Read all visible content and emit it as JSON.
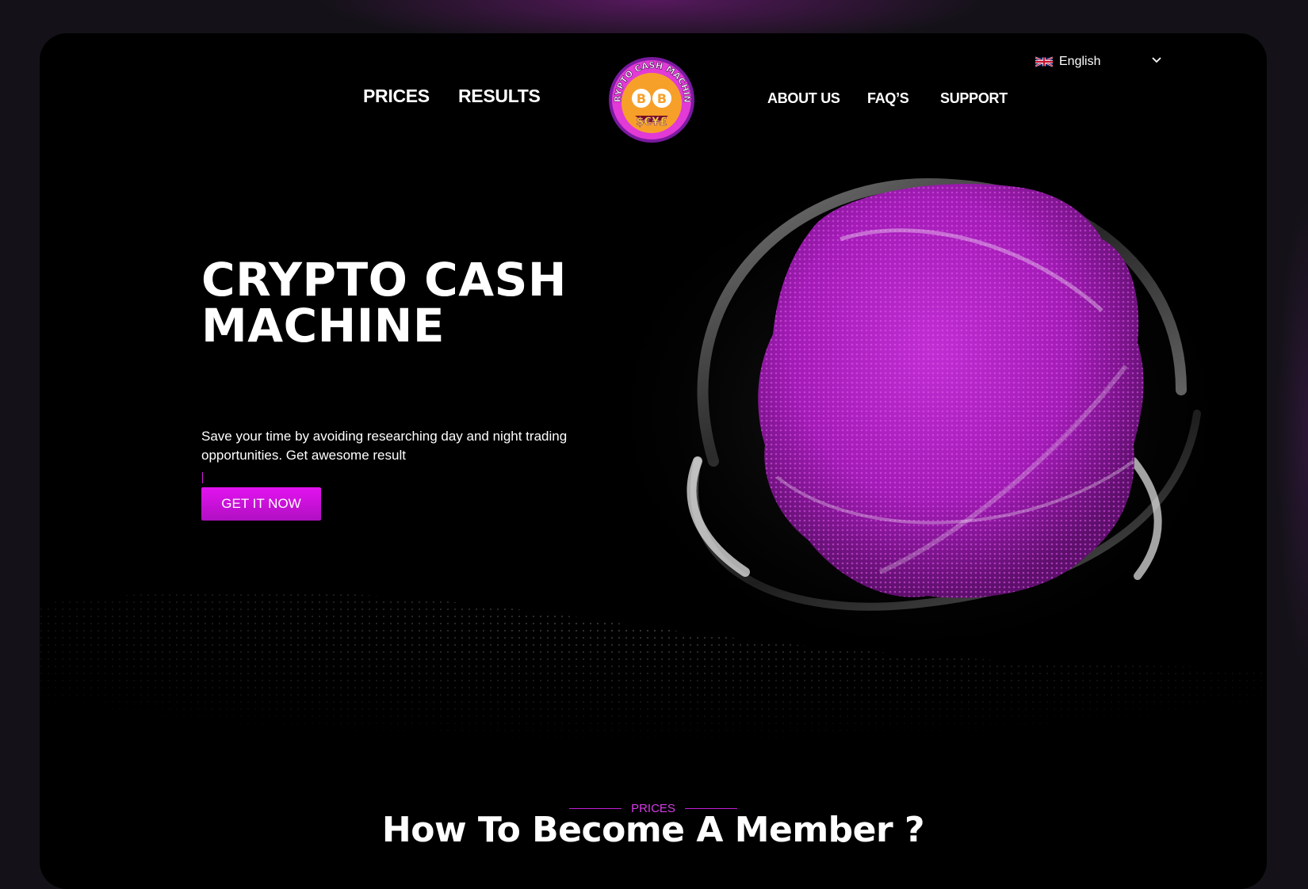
{
  "language": {
    "selected": "English",
    "flag": "uk-flag-icon"
  },
  "nav": {
    "left": [
      "PRICES",
      "RESULTS"
    ],
    "right": [
      "ABOUT US",
      "FAQ’S",
      "SUPPORT"
    ]
  },
  "logo": {
    "text": "CRYPTO CASH MACHINE",
    "alt": "crypto-cash-machine-logo"
  },
  "hero": {
    "title_line1": "CRYPTO CASH",
    "title_line2": "MACHINE",
    "description": "Save your time by avoiding researching day and night trading opportunities. Get awesome result",
    "cta_label": "GET IT NOW"
  },
  "prices_section": {
    "eyebrow": "PRICES",
    "title": "How To Become A Member ?"
  },
  "colors": {
    "accent": "#e313f0",
    "accent_dark": "#b00fc2",
    "background": "#000000",
    "outer_background": "#141218"
  }
}
